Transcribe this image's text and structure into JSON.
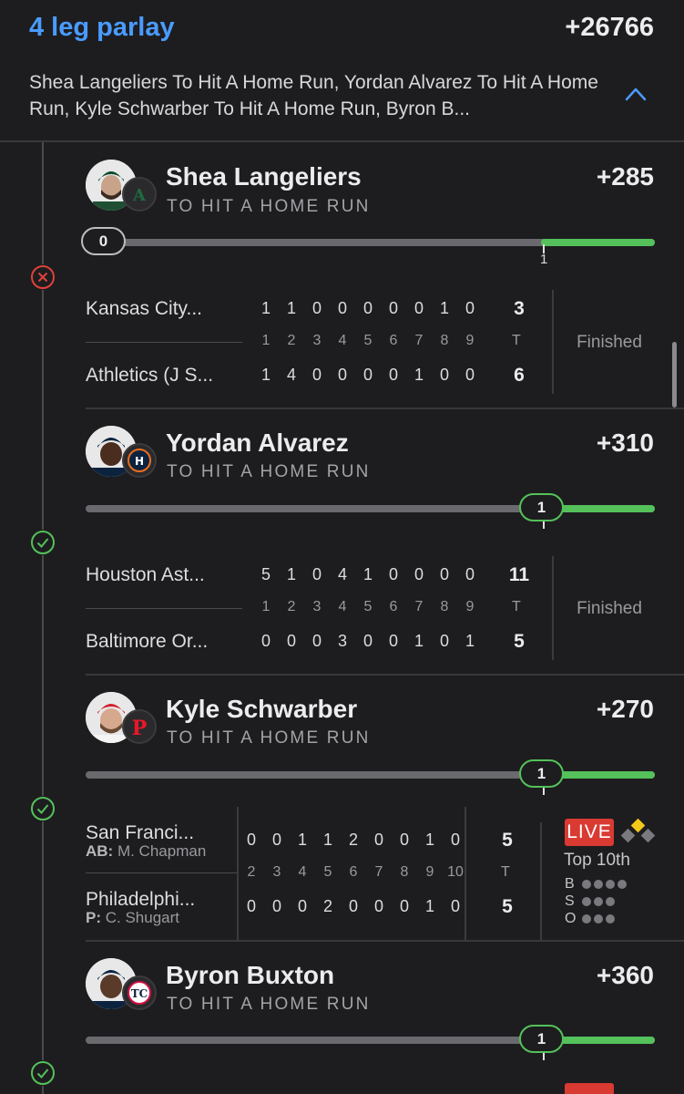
{
  "header": {
    "title": "4 leg parlay",
    "odds": "+26766",
    "description": "Shea Langeliers To Hit A Home Run, Yordan Alvarez To Hit A Home Run, Kyle Schwarber To Hit A Home Run, Byron B..."
  },
  "colors": {
    "accent": "#4a9bff",
    "success": "#54c15a",
    "fail": "#e0413a",
    "live": "#d93a32",
    "background": "#1d1d1f"
  },
  "legs": [
    {
      "player": "Shea Langeliers",
      "market": "TO HIT A HOME RUN",
      "odds": "+285",
      "status": "lost",
      "status_icon": "x-circle-icon",
      "progress": {
        "current": "0",
        "target": "1",
        "current_value": 0,
        "target_value": 1
      },
      "game": {
        "away": {
          "team": "Kansas City...",
          "innings": [
            "1",
            "1",
            "0",
            "0",
            "0",
            "0",
            "0",
            "1",
            "0"
          ],
          "total": "3"
        },
        "home": {
          "team": "Athletics (J S...",
          "innings": [
            "1",
            "4",
            "0",
            "0",
            "0",
            "0",
            "1",
            "0",
            "0"
          ],
          "total": "6"
        },
        "inning_labels": [
          "1",
          "2",
          "3",
          "4",
          "5",
          "6",
          "7",
          "8",
          "9"
        ],
        "total_label": "T",
        "status": "Finished"
      }
    },
    {
      "player": "Yordan Alvarez",
      "market": "TO HIT A HOME RUN",
      "odds": "+310",
      "status": "won",
      "status_icon": "check-circle-icon",
      "progress": {
        "current": "1",
        "target": "1",
        "current_value": 1,
        "target_value": 1
      },
      "game": {
        "away": {
          "team": "Houston Ast...",
          "innings": [
            "5",
            "1",
            "0",
            "4",
            "1",
            "0",
            "0",
            "0",
            "0"
          ],
          "total": "11"
        },
        "home": {
          "team": "Baltimore Or...",
          "innings": [
            "0",
            "0",
            "0",
            "3",
            "0",
            "0",
            "1",
            "0",
            "1"
          ],
          "total": "5"
        },
        "inning_labels": [
          "1",
          "2",
          "3",
          "4",
          "5",
          "6",
          "7",
          "8",
          "9"
        ],
        "total_label": "T",
        "status": "Finished"
      }
    },
    {
      "player": "Kyle Schwarber",
      "market": "TO HIT A HOME RUN",
      "odds": "+270",
      "status": "won",
      "status_icon": "check-circle-icon",
      "progress": {
        "current": "1",
        "target": "1",
        "current_value": 1,
        "target_value": 1
      },
      "game": {
        "away": {
          "team": "San Franci...",
          "sub_label": "AB:",
          "sub_value": "M. Chapman",
          "innings": [
            "0",
            "0",
            "1",
            "1",
            "2",
            "0",
            "0",
            "1",
            "0"
          ],
          "total": "5"
        },
        "home": {
          "team": "Philadelphi...",
          "sub_label": "P:",
          "sub_value": "C. Shugart",
          "innings": [
            "0",
            "0",
            "0",
            "2",
            "0",
            "0",
            "0",
            "1",
            "0"
          ],
          "total": "5"
        },
        "inning_labels": [
          "2",
          "3",
          "4",
          "5",
          "6",
          "7",
          "8",
          "9",
          "10"
        ],
        "total_label": "T",
        "live": "LIVE",
        "inning": "Top 10th",
        "balls_label": "B",
        "strikes_label": "S",
        "outs_label": "O",
        "balls": 0,
        "strikes": 0,
        "outs": 0
      }
    },
    {
      "player": "Byron Buxton",
      "market": "TO HIT A HOME RUN",
      "odds": "+360",
      "status": "won",
      "status_icon": "check-circle-icon",
      "progress": {
        "current": "1",
        "target": "1",
        "current_value": 1,
        "target_value": 1
      }
    }
  ]
}
